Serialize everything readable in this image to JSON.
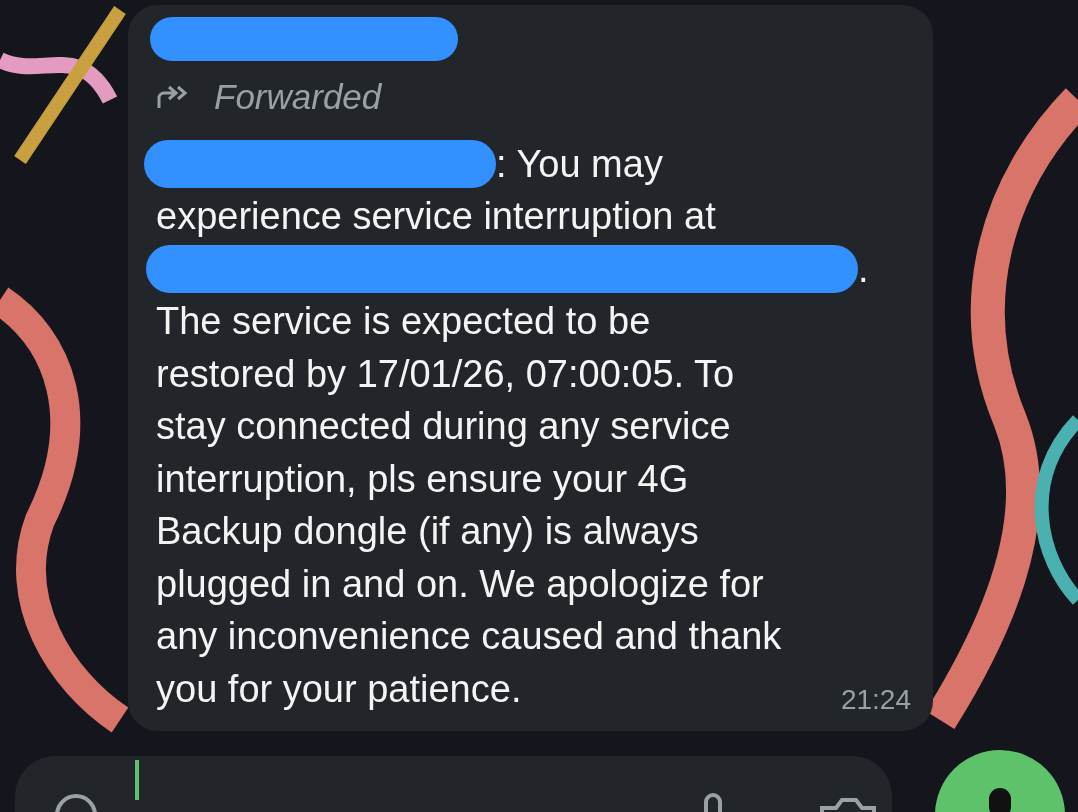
{
  "message": {
    "sender": {
      "kind": "redaction"
    },
    "forwarded_label": "Forwarded",
    "lines": [
      [
        {
          "kind": "redaction"
        },
        {
          "kind": "text",
          "text": ": You may"
        }
      ],
      [
        {
          "kind": "text",
          "text": "experience service interruption at"
        }
      ],
      [
        {
          "kind": "redaction"
        },
        {
          "kind": "text",
          "text": "."
        }
      ],
      [
        {
          "kind": "text",
          "text": "The service is expected to be"
        }
      ],
      [
        {
          "kind": "text",
          "text": "restored by 17/01/26, 07:00:05. To"
        }
      ],
      [
        {
          "kind": "text",
          "text": "stay connected during any service"
        }
      ],
      [
        {
          "kind": "text",
          "text": "interruption, pls ensure your 4G"
        }
      ],
      [
        {
          "kind": "text",
          "text": "Backup dongle (if any) is always"
        }
      ],
      [
        {
          "kind": "text",
          "text": "plugged in and on. We apologize for"
        }
      ],
      [
        {
          "kind": "text",
          "text": "any inconvenience caused and thank"
        }
      ],
      [
        {
          "kind": "text",
          "text": "you for your patience."
        }
      ]
    ],
    "time": "21:24"
  }
}
